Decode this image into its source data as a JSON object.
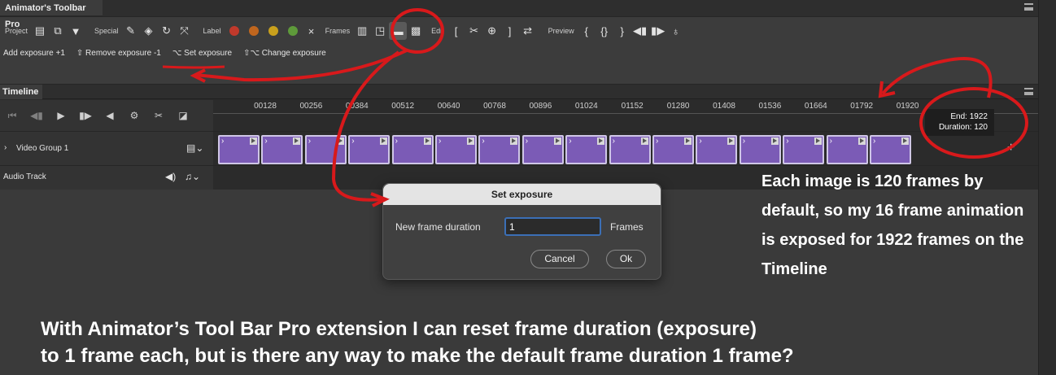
{
  "toolbar_panel": {
    "title": "Animator's Toolbar Pro",
    "groups": {
      "project": "Project",
      "special": "Special",
      "label": "Label",
      "frames": "Frames",
      "edit": "Edit",
      "preview": "Preview"
    },
    "label_colors": [
      "#c0392b",
      "#c0661e",
      "#c9a01c",
      "#5e9a3a"
    ],
    "label_clear": "×",
    "edit_glyphs": {
      "open_bracket": "[",
      "close_bracket": "]",
      "curly_open": "{",
      "curly_pair": "{}",
      "curly_close": "}"
    },
    "links": {
      "add_exposure": "Add exposure +1",
      "remove_exposure": "⇧ Remove exposure -1",
      "set_exposure": "⌥ Set exposure",
      "change_exposure": "⇧⌥ Change exposure"
    }
  },
  "timeline": {
    "tab": "Timeline",
    "ticks": [
      "00128",
      "00256",
      "00384",
      "00512",
      "00640",
      "00768",
      "00896",
      "01024",
      "01152",
      "01280",
      "01408",
      "01536",
      "01664",
      "01792",
      "01920"
    ],
    "tracks": {
      "video": "Video Group 1",
      "audio": "Audio Track"
    },
    "clip_count": 16,
    "tooltip": {
      "end": "End: 1922",
      "duration": "Duration:  120"
    },
    "add_symbol": "+"
  },
  "dialog": {
    "title": "Set exposure",
    "field_label": "New frame duration",
    "field_value": "1",
    "unit": "Frames",
    "cancel": "Cancel",
    "ok": "Ok"
  },
  "annotations": {
    "right_note": "Each image is 120 frames by default, so my 16 frame animation is exposed for 1922 frames on the Timeline",
    "bottom_line1": "With Animator’s Tool Bar Pro extension I can reset frame duration (exposure)",
    "bottom_line2": "to 1 frame each, but is there any way to make the default frame duration 1 frame?"
  }
}
